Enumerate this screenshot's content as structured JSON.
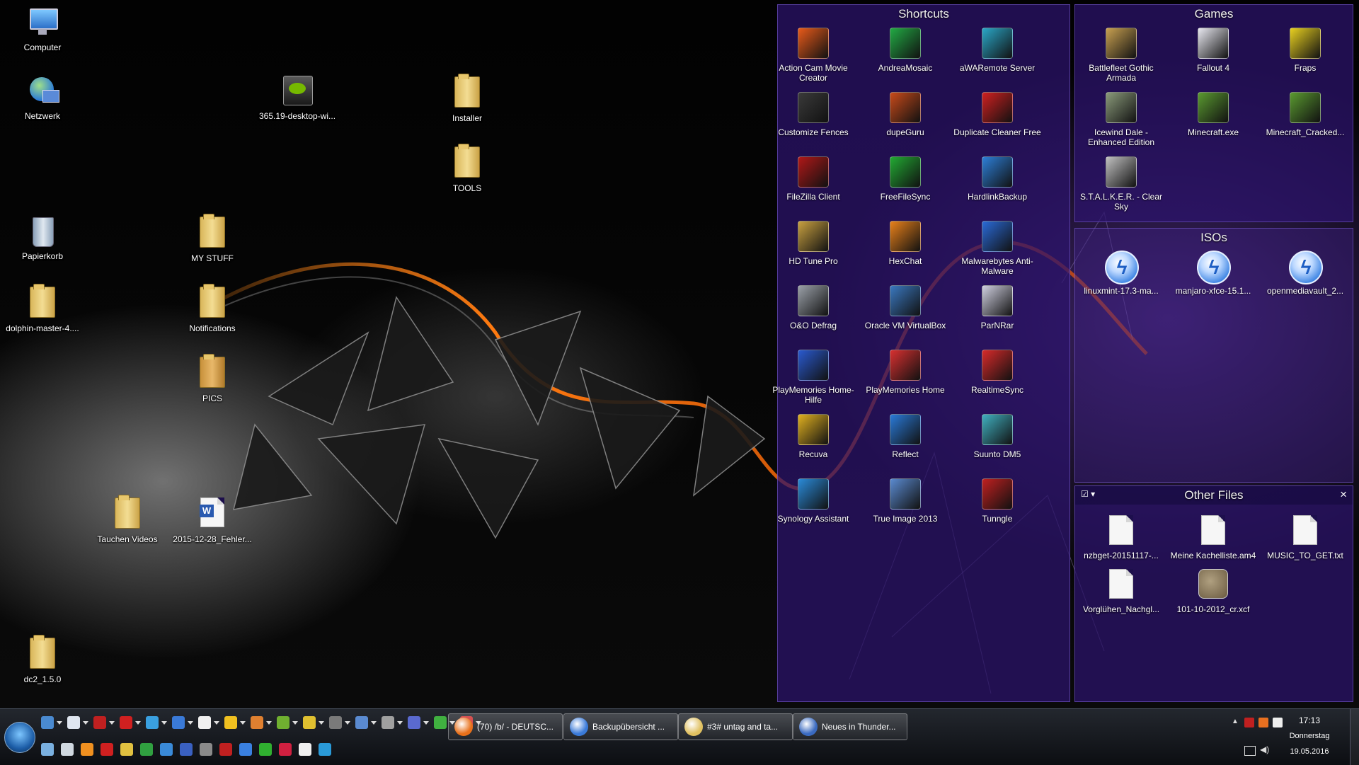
{
  "desktop": {
    "icons": [
      {
        "label": "Computer",
        "icon": "computer-icon"
      },
      {
        "label": "Netzwerk",
        "icon": "network-icon"
      },
      {
        "label": "Papierkorb",
        "icon": "recycle-bin-icon"
      },
      {
        "label": "dolphin-master-4....",
        "icon": "folder-icon"
      },
      {
        "label": "dc2_1.5.0",
        "icon": "folder-icon"
      },
      {
        "label": "365.19-desktop-wi...",
        "icon": "nvidia-installer-icon"
      },
      {
        "label": "MY STUFF",
        "icon": "folder-icon"
      },
      {
        "label": "Notifications",
        "icon": "folder-icon"
      },
      {
        "label": "PICS",
        "icon": "folder-icon"
      },
      {
        "label": "Tauchen Videos",
        "icon": "folder-icon"
      },
      {
        "label": "2015-12-28_Fehler...",
        "icon": "word-document-icon"
      },
      {
        "label": "Installer",
        "icon": "folder-icon"
      },
      {
        "label": "TOOLS",
        "icon": "folder-icon"
      }
    ]
  },
  "fences": {
    "shortcuts": {
      "title": "Shortcuts",
      "items": [
        {
          "label": "Action Cam Movie Creator",
          "icon": "action-cam-icon",
          "color": "#e85a1a"
        },
        {
          "label": "AndreaMosaic",
          "icon": "mosaic-icon",
          "color": "#22aa44"
        },
        {
          "label": "aWARemote Server",
          "icon": "play-icon",
          "color": "#2aa7c8"
        },
        {
          "label": "Customize Fences",
          "icon": "fences-icon",
          "color": "#3a3a3a"
        },
        {
          "label": "dupeGuru",
          "icon": "dupeguru-icon",
          "color": "#c84a1a"
        },
        {
          "label": "Duplicate Cleaner Free",
          "icon": "duplicate-cleaner-icon",
          "color": "#d02020"
        },
        {
          "label": "FileZilla Client",
          "icon": "filezilla-icon",
          "color": "#b01818"
        },
        {
          "label": "FreeFileSync",
          "icon": "sync-icon",
          "color": "#22aa33"
        },
        {
          "label": "HardlinkBackup",
          "icon": "hardlink-backup-icon",
          "color": "#2d7fd8"
        },
        {
          "label": "HD Tune Pro",
          "icon": "hd-tune-icon",
          "color": "#c8a040"
        },
        {
          "label": "HexChat",
          "icon": "hexchat-icon",
          "color": "#e8801a"
        },
        {
          "label": "Malwarebytes Anti-Malware",
          "icon": "malwarebytes-icon",
          "color": "#2a6ad8"
        },
        {
          "label": "O&O Defrag",
          "icon": "defrag-icon",
          "color": "#9aa0a8"
        },
        {
          "label": "Oracle VM VirtualBox",
          "icon": "virtualbox-icon",
          "color": "#3a78c0"
        },
        {
          "label": "ParNRar",
          "icon": "parnrar-icon",
          "color": "#d0d0e0"
        },
        {
          "label": "PlayMemories Home-Hilfe",
          "icon": "help-icon",
          "color": "#2a5ad0"
        },
        {
          "label": "PlayMemories Home",
          "icon": "playmemories-icon",
          "color": "#d83030"
        },
        {
          "label": "RealtimeSync",
          "icon": "realtimesync-icon",
          "color": "#d82a2a"
        },
        {
          "label": "Recuva",
          "icon": "recuva-icon",
          "color": "#e0b020"
        },
        {
          "label": "Reflect",
          "icon": "reflect-icon",
          "color": "#2a7ad8"
        },
        {
          "label": "Suunto DM5",
          "icon": "suunto-icon",
          "color": "#40b0c0"
        },
        {
          "label": "Synology Assistant",
          "icon": "synology-icon",
          "color": "#2a8ad8"
        },
        {
          "label": "True Image 2013",
          "icon": "true-image-icon",
          "color": "#5a8ad0"
        },
        {
          "label": "Tunngle",
          "icon": "tunngle-icon",
          "color": "#c02020"
        }
      ]
    },
    "games": {
      "title": "Games",
      "items": [
        {
          "label": "Battlefleet Gothic Armada",
          "icon": "battlefleet-icon",
          "color": "#c8a050"
        },
        {
          "label": "Fallout 4",
          "icon": "fallout-icon",
          "color": "#e8e8f0"
        },
        {
          "label": "Fraps",
          "icon": "fraps-icon",
          "color": "#e8d020"
        },
        {
          "label": "Icewind Dale - Enhanced Edition",
          "icon": "icewind-dale-icon",
          "color": "#8a9a7a"
        },
        {
          "label": "Minecraft.exe",
          "icon": "minecraft-icon",
          "color": "#5a9a30"
        },
        {
          "label": "Minecraft_Cracked...",
          "icon": "minecraft-icon",
          "color": "#5a9a30"
        },
        {
          "label": "S.T.A.L.K.E.R. - Clear Sky",
          "icon": "stalker-icon",
          "color": "#c0c0c0"
        }
      ]
    },
    "isos": {
      "title": "ISOs",
      "items": [
        {
          "label": "linuxmint-17.3-ma...",
          "icon": "daemon-tools-icon"
        },
        {
          "label": "manjaro-xfce-15.1...",
          "icon": "daemon-tools-icon"
        },
        {
          "label": "openmediavault_2...",
          "icon": "daemon-tools-icon"
        }
      ]
    },
    "other": {
      "title": "Other Files",
      "close": "×",
      "menu": "☑ ▾",
      "items": [
        {
          "label": "nzbget-20151117-...",
          "icon": "document-icon"
        },
        {
          "label": "Meine Kachelliste.am4",
          "icon": "document-icon"
        },
        {
          "label": "MUSIC_TO_GET.txt",
          "icon": "text-file-icon"
        },
        {
          "label": "Vorglühen_Nachgl...",
          "icon": "document-icon"
        },
        {
          "label": "101-10-2012_cr.xcf",
          "icon": "gimp-icon"
        }
      ]
    }
  },
  "taskbar": {
    "tasks": [
      {
        "label": "(70) /b/ - DEUTSC...",
        "icon": "firefox-icon",
        "color": "#e8701a"
      },
      {
        "label": "Backupübersicht ...",
        "icon": "backup-icon",
        "color": "#3a7ad8"
      },
      {
        "label": "#3# untag and ta...",
        "icon": "folder-icon",
        "color": "#e0c060"
      },
      {
        "label": "Neues in Thunder...",
        "icon": "thunderbird-icon",
        "color": "#3a6ac0"
      }
    ],
    "clock": {
      "time": "17:13",
      "day": "Donnerstag",
      "date": "19.05.2016"
    }
  }
}
